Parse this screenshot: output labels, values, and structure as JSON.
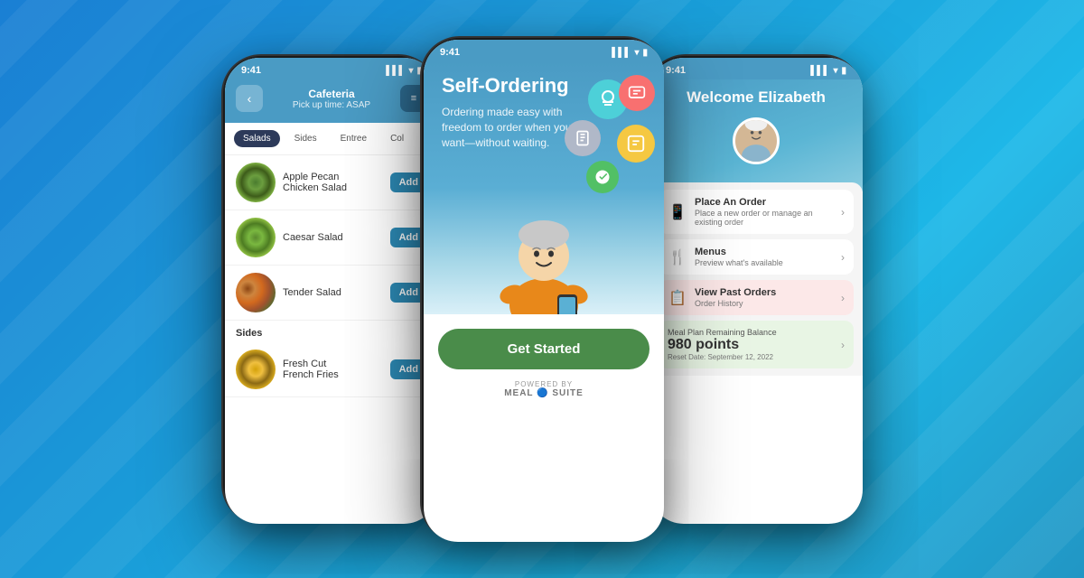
{
  "background": {
    "gradient_start": "#1a7fd4",
    "gradient_end": "#2196c4"
  },
  "phone_left": {
    "status_time": "9:41",
    "header": {
      "title": "Cafeteria",
      "subtitle": "Pick up time: ASAP"
    },
    "tabs": [
      {
        "label": "Salads",
        "active": true
      },
      {
        "label": "Sides",
        "active": false
      },
      {
        "label": "Entree",
        "active": false
      },
      {
        "label": "Col",
        "active": false
      }
    ],
    "items": [
      {
        "name": "Apple Pecan\nChicken Salad",
        "add_label": "Add",
        "type": "salad"
      },
      {
        "name": "Caesar Salad",
        "add_label": "Add",
        "type": "caesar"
      },
      {
        "name": "Tender Salad",
        "add_label": "Add",
        "type": "tender"
      },
      {
        "name": "Fresh Cut\nFrench Fries",
        "add_label": "Add",
        "type": "fries"
      }
    ],
    "section_header": "Sides"
  },
  "phone_center": {
    "status_time": "9:41",
    "hero": {
      "title": "Self-Ordering",
      "subtitle": "Ordering made easy with freedom to order when you want—without waiting."
    },
    "get_started_label": "Get Started",
    "powered_by": "POWERED BY",
    "powered_logo": "MEAL 🔵 SUITE"
  },
  "phone_right": {
    "status_time": "9:41",
    "welcome": "Welcome Elizabeth",
    "menu_items": [
      {
        "title": "Place An Order",
        "subtitle": "Place a new order or manage an existing order",
        "icon": "📱",
        "type": "white"
      },
      {
        "title": "Menus",
        "subtitle": "Preview what's available",
        "icon": "🍴",
        "type": "white"
      },
      {
        "title": "View Past Orders",
        "subtitle": "Order History",
        "icon": "📋",
        "type": "pink"
      }
    ],
    "meal_plan": {
      "label": "Meal Plan Remaining Balance",
      "points": "980 points",
      "reset": "Reset Date: September 12, 2022"
    }
  }
}
